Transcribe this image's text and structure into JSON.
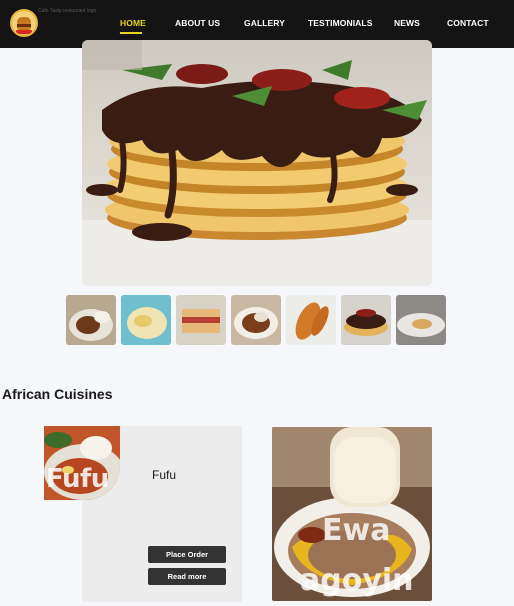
{
  "nav": {
    "logo_alt": "Cafe Tasty restaurant logo",
    "links": [
      "HOME",
      "ABOUT US",
      "GALLERY",
      "TESTIMONIALS",
      "NEWS",
      "CONTACT"
    ],
    "active": "HOME",
    "accent_color": "#e7d21c",
    "background": "#141414"
  },
  "gallery": {
    "hero_image": "chocolate-pancake-stack-photo",
    "thumbnails": [
      "amala-dish-photo",
      "pasta-salad-photo",
      "sandwich-photo",
      "soup-bowl-photo",
      "fried-plantain-photo",
      "pancake-stack-photo",
      "plated-dish-photo"
    ]
  },
  "section": {
    "title": "African Cuisines"
  },
  "cards": [
    {
      "name": "Fufu",
      "image_label": "Fufu",
      "place_order_label": "Place Order",
      "read_more_label": "Read more"
    },
    {
      "image_label_line1": "Ewa",
      "image_label_line2": "agoyin"
    }
  ]
}
